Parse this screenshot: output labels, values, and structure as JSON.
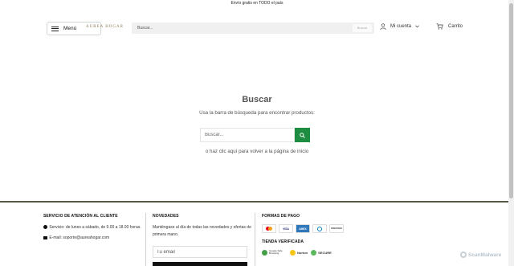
{
  "announcement": "Envío gratis en TODO el país",
  "header": {
    "menu_label": "Menú",
    "logo_text": "AUREA HOGAR",
    "search_placeholder": "Buscar...",
    "search_button": "Buscar",
    "account_label": "Mi cuenta",
    "cart_label": "Carrito"
  },
  "main": {
    "title": "Buscar",
    "subtitle": "Usa la barra de búsqueda para encontrar productos:",
    "search_placeholder": "Buscar...",
    "home_link": "o haz clic aquí para volver a la página de inicio"
  },
  "footer": {
    "service": {
      "heading": "SERVICIO DE ATENCIÓN AL CLIENTE",
      "hours": "Servicio: de lunes a sábado, de 9.00 a 18.00 horas.",
      "email": "E-mail: soporte@aureahogar.com"
    },
    "news": {
      "heading": "NOVEDADES",
      "text": "Manténgase al día de todas las novedades y ofertas de primera mano.",
      "email_placeholder": "Tu email"
    },
    "payment": {
      "heading": "FORMAS DE PAGO",
      "methods": [
        "mastercard",
        "VISA",
        "AMEX",
        "diners",
        "DISCOVER"
      ]
    },
    "verified": {
      "heading": "TIENDA VERIFICADA",
      "badges": [
        "Google Safe Browsing",
        "Norton",
        "SECURE"
      ]
    }
  },
  "watermark": "ScanMalware",
  "colors": {
    "accent_green": "#1e8d3f",
    "footer_border": "#555b46"
  }
}
